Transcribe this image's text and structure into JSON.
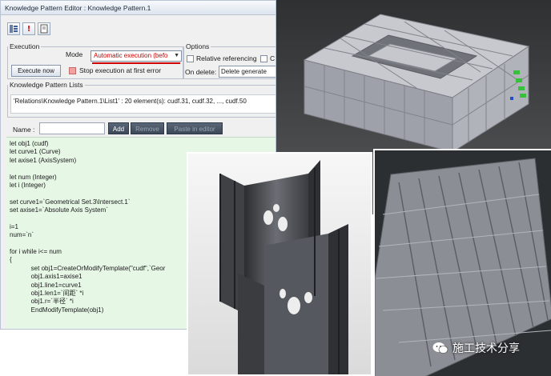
{
  "window": {
    "title": "Knowledge Pattern Editor : Knowledge Pattern.1"
  },
  "toolbar": {
    "icons": [
      "knowledge-list-icon",
      "exclamation-icon",
      "page-icon"
    ],
    "excl_glyph": "!"
  },
  "execution": {
    "legend": "Execution",
    "mode_label": "Mode",
    "mode_value": "Automatic execution (befo",
    "execute_button": "Execute now",
    "stop_label": "Stop execution at first error"
  },
  "options": {
    "legend": "Options",
    "relative_label": "Relative referencing",
    "relative_extra": "C",
    "ondelete_label": "On delete:",
    "ondelete_value": "Delete generate"
  },
  "lists": {
    "legend": "Knowledge Pattern Lists",
    "entry": "'Relations\\Knowledge Pattern.1\\List1' : 20 element(s): cudf.31, cudf.32, ..., cudf.50"
  },
  "name_row": {
    "label": "Name :",
    "value": "",
    "add": "Add",
    "remove": "Remove",
    "paste": "Paste in editor"
  },
  "code": [
    "let obj1 (cudf)",
    "let curve1 (Curve)",
    "let axise1 (AxisSystem)",
    "",
    "let num (Integer)",
    "let i (Integer)",
    "",
    "set curve1=`Geometrical Set.3\\Intersect.1`",
    "set axise1=`Absolute Axis System`",
    "",
    "i=1",
    "num=`n`",
    "",
    "for i while i<= num",
    "{",
    "            set obj1=CreateOrModifyTemplate(\"cudf\",`Geor",
    "            obj1.axis1=axise1",
    "            obj1.line1=curve1",
    "            obj1.len1=`间距` *i",
    "            obj1.r=`半径` *i",
    "            EndModifyTemplate(obj1)"
  ],
  "watermark": {
    "text": "施工技术分享",
    "icon": "wechat-icon"
  },
  "colors": {
    "accent_red": "#d00000",
    "code_bg": "#e6f7e6",
    "model_gray": "#bfc1c8",
    "model_green": "#35c23a"
  }
}
